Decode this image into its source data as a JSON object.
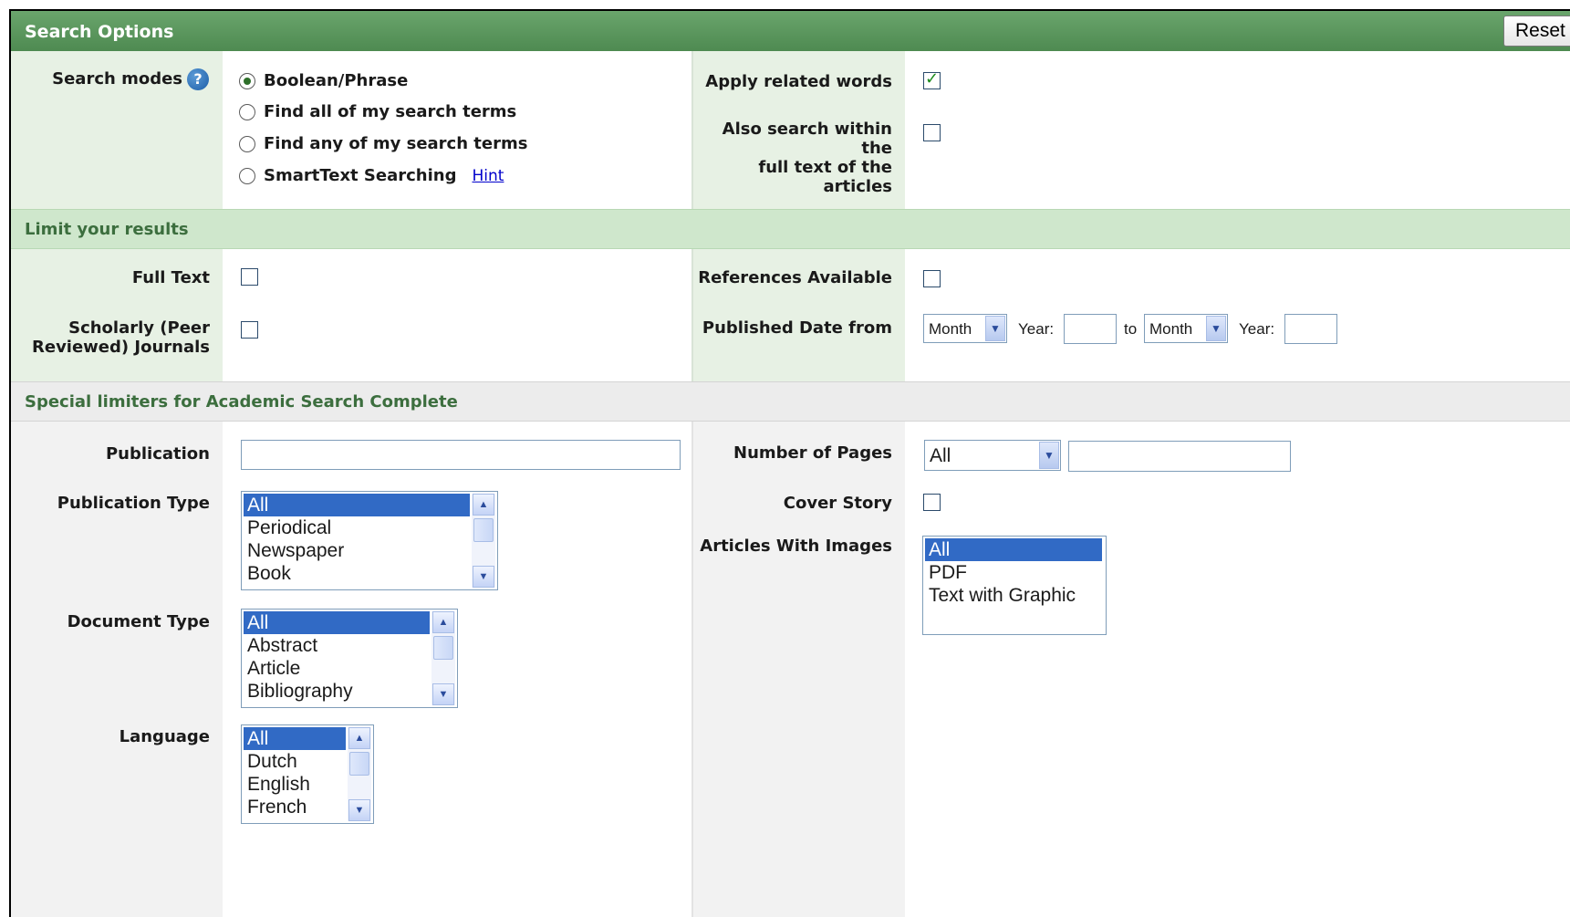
{
  "header": {
    "title": "Search Options",
    "reset_label": "Reset"
  },
  "search_modes": {
    "label": "Search modes",
    "help_icon": "question-mark-icon",
    "options": [
      {
        "label": "Boolean/Phrase",
        "checked": true
      },
      {
        "label": "Find all of my search terms",
        "checked": false
      },
      {
        "label": "Find any of my search terms",
        "checked": false
      },
      {
        "label": "SmartText Searching",
        "checked": false
      }
    ],
    "hint_label": "Hint"
  },
  "apply_related_words": {
    "label": "Apply related words",
    "checked": true
  },
  "full_text_search": {
    "label_line1": "Also search within the",
    "label_line2": "full text of the articles",
    "checked": false
  },
  "limit": {
    "title": "Limit your results",
    "full_text": {
      "label": "Full Text",
      "checked": false
    },
    "references": {
      "label": "References Available",
      "checked": false
    },
    "scholarly": {
      "label_line1": "Scholarly (Peer",
      "label_line2": "Reviewed) Journals",
      "checked": false
    },
    "published_date": {
      "label": "Published Date from",
      "from_month": "Month",
      "year_label": "Year:",
      "to_label": "to",
      "to_month": "Month"
    }
  },
  "special": {
    "title": "Special limiters for Academic Search Complete",
    "publication": {
      "label": "Publication",
      "value": ""
    },
    "publication_type": {
      "label": "Publication Type",
      "options": [
        "All",
        "Periodical",
        "Newspaper",
        "Book"
      ]
    },
    "document_type": {
      "label": "Document Type",
      "options": [
        "All",
        "Abstract",
        "Article",
        "Bibliography"
      ]
    },
    "language": {
      "label": "Language",
      "options": [
        "All",
        "Dutch",
        "English",
        "French"
      ]
    },
    "number_of_pages": {
      "label": "Number of Pages",
      "selected": "All",
      "value": ""
    },
    "cover_story": {
      "label": "Cover Story",
      "checked": false
    },
    "articles_with_images": {
      "label": "Articles With Images",
      "options": [
        "All",
        "PDF",
        "Text with Graphic"
      ]
    }
  },
  "colors": {
    "header_green": "#5a9a5d",
    "band_green": "#cfe7cc",
    "label_bg": "#e7f1e4",
    "selection_blue": "#316ac5"
  }
}
